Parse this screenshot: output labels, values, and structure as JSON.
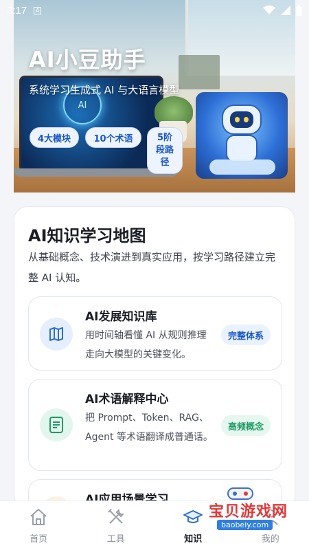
{
  "status_bar": {
    "time": "3:17",
    "sim_label": "A"
  },
  "hero": {
    "title": "AI小豆助手",
    "subtitle": "系统学习生成式 AI 与大语言模型",
    "chips": [
      "4大模块",
      "10个术语",
      "5阶段路径"
    ],
    "art_core_label": "AI"
  },
  "map_section": {
    "title": "AI知识学习地图",
    "description": "从基础概念、技术演进到真实应用，按学习路径建立完整 AI 认知。"
  },
  "features": [
    {
      "title": "AI发展知识库",
      "description": "用时间轴看懂 AI 从规则推理走向大模型的关键变化。",
      "badge": "完整体系",
      "icon": "map-icon"
    },
    {
      "title": "AI术语解释中心",
      "description": "把 Prompt、Token、RAG、Agent 等术语翻译成普通话。",
      "badge": "高频概念",
      "icon": "document-icon"
    },
    {
      "title": "AI应用场景学习",
      "description": "",
      "badge": "",
      "icon": "lightbulb-icon"
    }
  ],
  "nav": [
    {
      "label": "首页",
      "icon": "home-icon",
      "active": false
    },
    {
      "label": "工具",
      "icon": "tools-icon",
      "active": false
    },
    {
      "label": "知识",
      "icon": "graduation-cap-icon",
      "active": true
    },
    {
      "label": "我的",
      "icon": "user-icon",
      "active": false
    }
  ],
  "watermark": {
    "text": "宝贝游戏网",
    "url": "baobeiy.com"
  },
  "colors": {
    "accent": "#1a57c9",
    "green": "#1f9b63"
  }
}
